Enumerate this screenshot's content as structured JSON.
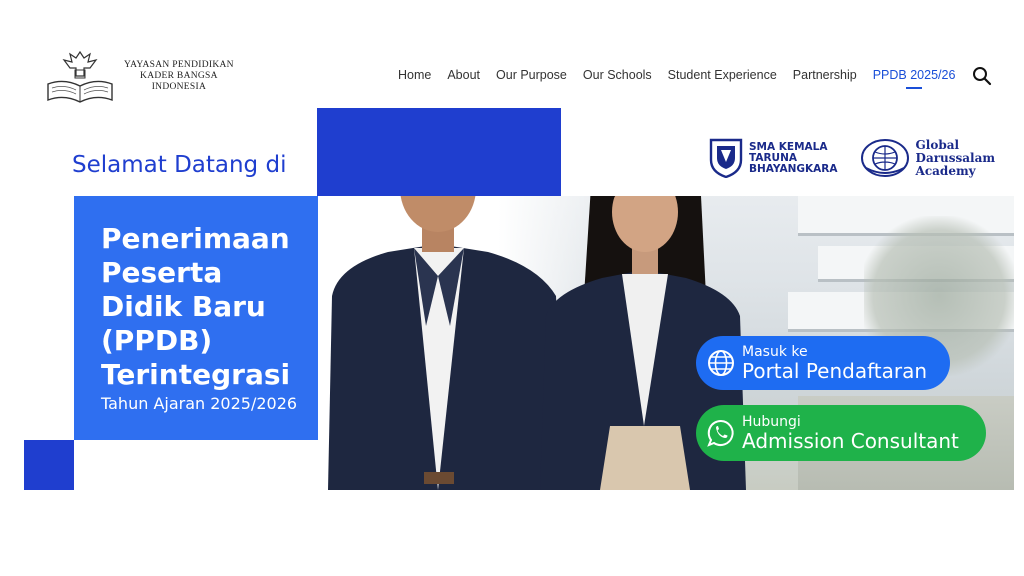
{
  "header": {
    "logo_lines": [
      "YAYASAN PENDIDIKAN",
      "KADER BANGSA",
      "INDONESIA"
    ],
    "nav": [
      {
        "label": "Home"
      },
      {
        "label": "About"
      },
      {
        "label": "Our Purpose"
      },
      {
        "label": "Our Schools"
      },
      {
        "label": "Student Experience"
      },
      {
        "label": "Partnership"
      },
      {
        "label": "PPDB 2025/26",
        "active": true
      }
    ],
    "search_icon": "search-icon"
  },
  "hero": {
    "welcome": "Selamat Datang di",
    "title": "Penerimaan Peserta Didik Baru (PPDB) Terintegrasi",
    "year": "Tahun Ajaran 2025/2026"
  },
  "schools": [
    {
      "lines": [
        "SMA KEMALA",
        "TARUNA",
        "BHAYANGKARA"
      ],
      "icon": "shield-crest-icon"
    },
    {
      "lines": [
        "Global",
        "Darussalam",
        "Academy"
      ],
      "icon": "globe-crest-icon"
    }
  ],
  "cta": {
    "portal": {
      "small": "Masuk ke",
      "big": "Portal Pendaftaran",
      "icon": "globe-icon"
    },
    "whatsapp": {
      "small": "Hubungi",
      "big": "Admission Consultant",
      "icon": "whatsapp-icon"
    }
  },
  "colors": {
    "primary_blue": "#1f3ecf",
    "bright_blue": "#2f6ff0",
    "cta_blue": "#1e6cf2",
    "cta_green": "#1fb24a"
  }
}
